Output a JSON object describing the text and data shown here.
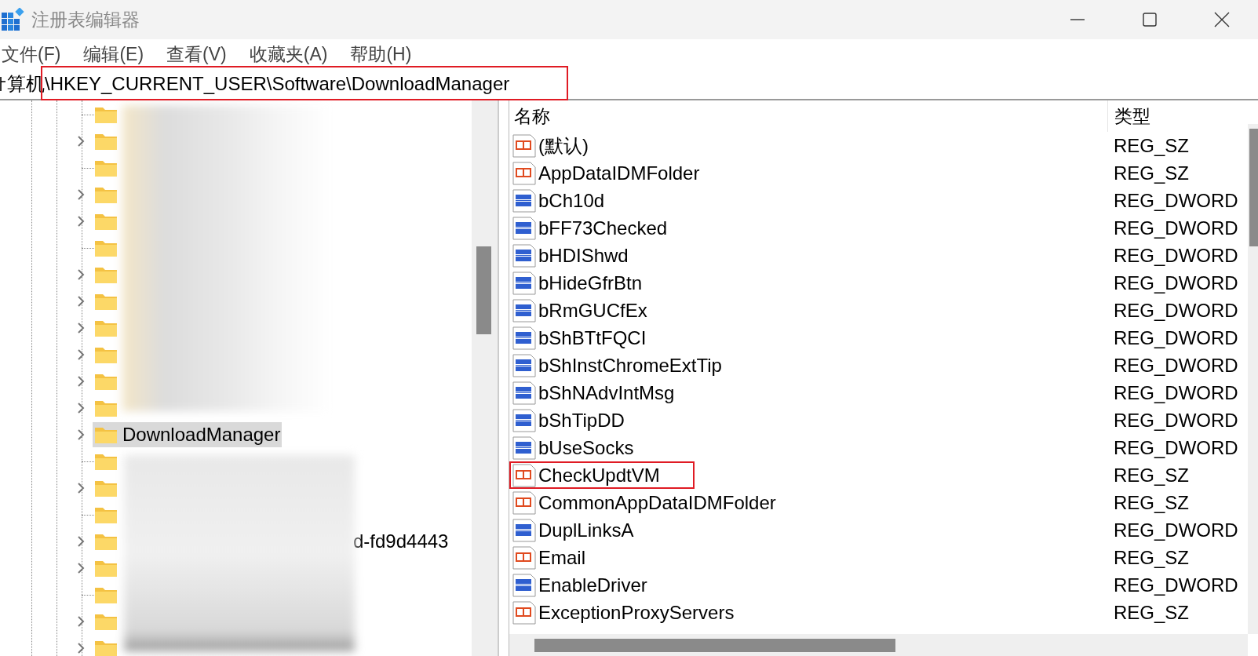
{
  "window": {
    "title": "注册表编辑器"
  },
  "menu": [
    "文件(F)",
    "编辑(E)",
    "查看(V)",
    "收藏夹(A)",
    "帮助(H)"
  ],
  "address_bar": {
    "value": "算机\\HKEY_CURRENT_USER\\Software\\DownloadManager",
    "highlighted": true
  },
  "tree": [
    {
      "expandable": false,
      "selected": false
    },
    {
      "expandable": true,
      "selected": false
    },
    {
      "expandable": false,
      "selected": false
    },
    {
      "expandable": true,
      "selected": false
    },
    {
      "expandable": true,
      "selected": false
    },
    {
      "expandable": false,
      "selected": false
    },
    {
      "expandable": true,
      "selected": false
    },
    {
      "expandable": true,
      "selected": false
    },
    {
      "expandable": true,
      "selected": false
    },
    {
      "expandable": true,
      "selected": false
    },
    {
      "expandable": true,
      "selected": false
    },
    {
      "expandable": true,
      "selected": false
    },
    {
      "expandable": true,
      "selected": true,
      "label": "DownloadManager"
    },
    {
      "expandable": false,
      "selected": false
    },
    {
      "expandable": true,
      "selected": false
    },
    {
      "expandable": false,
      "selected": false
    },
    {
      "expandable": true,
      "selected": false,
      "label": "d-fd9d4443",
      "partly_covered": true
    },
    {
      "expandable": true,
      "selected": false
    },
    {
      "expandable": false,
      "selected": false
    },
    {
      "expandable": true,
      "selected": false
    },
    {
      "expandable": true,
      "selected": false
    }
  ],
  "values_table": {
    "columns": [
      "名称",
      "类型"
    ],
    "rows": [
      {
        "kind": "string",
        "name": "(默认)",
        "type": "REG_SZ",
        "highlighted": false
      },
      {
        "kind": "string",
        "name": "AppDataIDMFolder",
        "type": "REG_SZ",
        "highlighted": false
      },
      {
        "kind": "binary",
        "name": "bCh10d",
        "type": "REG_DWORD",
        "highlighted": false
      },
      {
        "kind": "binary",
        "name": "bFF73Checked",
        "type": "REG_DWORD",
        "highlighted": false
      },
      {
        "kind": "binary",
        "name": "bHDIShwd",
        "type": "REG_DWORD",
        "highlighted": false
      },
      {
        "kind": "binary",
        "name": "bHideGfrBtn",
        "type": "REG_DWORD",
        "highlighted": false
      },
      {
        "kind": "binary",
        "name": "bRmGUCfEx",
        "type": "REG_DWORD",
        "highlighted": false
      },
      {
        "kind": "binary",
        "name": "bShBTtFQCI",
        "type": "REG_DWORD",
        "highlighted": false
      },
      {
        "kind": "binary",
        "name": "bShInstChromeExtTip",
        "type": "REG_DWORD",
        "highlighted": false
      },
      {
        "kind": "binary",
        "name": "bShNAdvIntMsg",
        "type": "REG_DWORD",
        "highlighted": false
      },
      {
        "kind": "binary",
        "name": "bShTipDD",
        "type": "REG_DWORD",
        "highlighted": false
      },
      {
        "kind": "binary",
        "name": "bUseSocks",
        "type": "REG_DWORD",
        "highlighted": false
      },
      {
        "kind": "string",
        "name": "CheckUpdtVM",
        "type": "REG_SZ",
        "highlighted": true
      },
      {
        "kind": "string",
        "name": "CommonAppDataIDMFolder",
        "type": "REG_SZ",
        "highlighted": false
      },
      {
        "kind": "binary",
        "name": "DuplLinksA",
        "type": "REG_DWORD",
        "highlighted": false
      },
      {
        "kind": "string",
        "name": "Email",
        "type": "REG_SZ",
        "highlighted": false
      },
      {
        "kind": "binary",
        "name": "EnableDriver",
        "type": "REG_DWORD",
        "highlighted": false
      },
      {
        "kind": "string",
        "name": "ExceptionProxyServers",
        "type": "REG_SZ",
        "highlighted": false
      }
    ]
  }
}
